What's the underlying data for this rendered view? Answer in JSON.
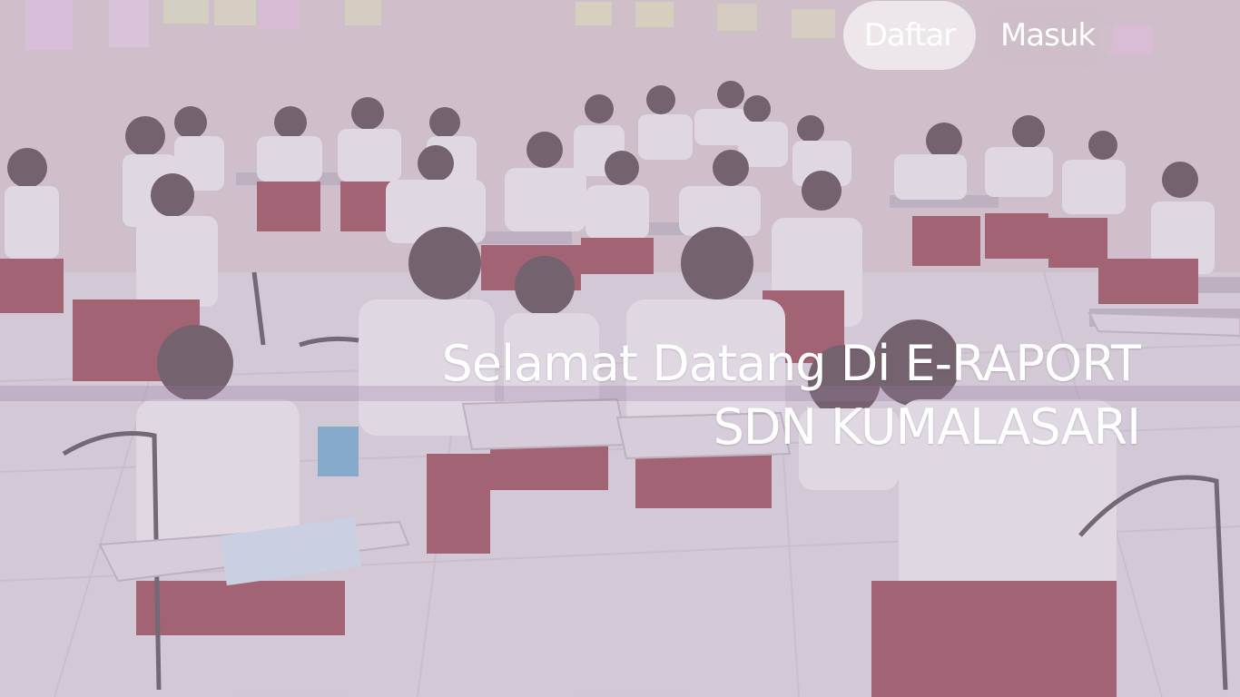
{
  "nav": {
    "register_label": "Daftar",
    "login_label": "Masuk"
  },
  "hero": {
    "title_line1": "Selamat Datang Di E-RAPORT",
    "title_line2": "SDN KUMALASARI"
  },
  "colors": {
    "overlay_tint": "#c4b2ce",
    "uniform_shirt": "#ffffff",
    "uniform_skirt": "#8a2a33",
    "wall": "#d8c9c9",
    "floor": "#dcd6dc"
  },
  "background": {
    "image_subject": "classroom-students-photo"
  }
}
